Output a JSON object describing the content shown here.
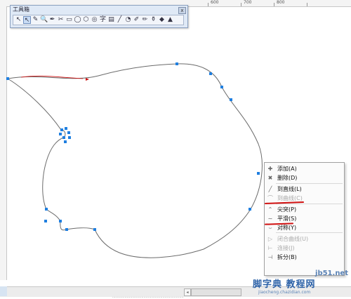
{
  "ruler": {
    "ticks": [
      "600",
      "700",
      "800"
    ]
  },
  "toolbox": {
    "title": "工具箱",
    "close": "x",
    "tools": [
      {
        "name": "pointer-tool-icon",
        "glyph": "↖"
      },
      {
        "name": "shape-tool-icon",
        "glyph": "↖",
        "active": true
      },
      {
        "name": "zoom-tool-icon",
        "glyph": "✎"
      },
      {
        "name": "magnify-tool-icon",
        "glyph": "🔍"
      },
      {
        "name": "pen-tool-icon",
        "glyph": "✒"
      },
      {
        "name": "node-tool-icon",
        "glyph": "✂"
      },
      {
        "name": "rectangle-tool-icon",
        "glyph": "▭"
      },
      {
        "name": "ellipse-tool-icon",
        "glyph": "◯"
      },
      {
        "name": "polygon-tool-icon",
        "glyph": "⬡"
      },
      {
        "name": "spiral-tool-icon",
        "glyph": "◎"
      },
      {
        "name": "text-tool-icon",
        "glyph": "字"
      },
      {
        "name": "table-tool-icon",
        "glyph": "▤"
      },
      {
        "name": "line-tool-icon",
        "glyph": "╱"
      },
      {
        "name": "blend-tool-icon",
        "glyph": "◔"
      },
      {
        "name": "eyedropper-tool-icon",
        "glyph": "✐"
      },
      {
        "name": "brush-tool-icon",
        "glyph": "✏"
      },
      {
        "name": "fill-tool-icon",
        "glyph": "⚱"
      },
      {
        "name": "bucket-tool-icon",
        "glyph": "◆"
      },
      {
        "name": "outline-tool-icon",
        "glyph": "▲"
      }
    ]
  },
  "context_menu": {
    "items": [
      {
        "icon": "✚",
        "label": "添加(A)",
        "disabled": false,
        "name": "menu-add"
      },
      {
        "icon": "✖",
        "label": "删除(D)",
        "disabled": false,
        "name": "menu-delete"
      },
      {
        "icon": "╱",
        "label": "到直线(L)",
        "disabled": false,
        "name": "menu-to-line"
      },
      {
        "icon": "⌒",
        "label": "到曲线(C)",
        "disabled": true,
        "name": "menu-to-curve"
      },
      {
        "icon": "⌃",
        "label": "尖突(P)",
        "disabled": false,
        "name": "menu-cusp"
      },
      {
        "icon": "∼",
        "label": "平滑(S)",
        "disabled": false,
        "name": "menu-smooth"
      },
      {
        "icon": "⌣",
        "label": "对称(Y)",
        "disabled": false,
        "name": "menu-symmetric"
      },
      {
        "icon": "▷",
        "label": "闭合曲线(U)",
        "disabled": true,
        "name": "menu-close-curve"
      },
      {
        "icon": "⊢",
        "label": "连接(J)",
        "disabled": true,
        "name": "menu-join"
      },
      {
        "icon": "⊣",
        "label": "拆分(B)",
        "disabled": false,
        "name": "menu-break"
      }
    ]
  },
  "scrollbar": {
    "left_arrow": "◂"
  },
  "status": {
    "text": "................................................................"
  },
  "watermark": {
    "line1": "jb51.net",
    "line2": "脚字典 教程网",
    "line3": "jiaocheng.chazidian.com"
  },
  "colors": {
    "curve": "#6b6b6b",
    "node": "#1f7fe0",
    "highlight": "#d01010"
  }
}
